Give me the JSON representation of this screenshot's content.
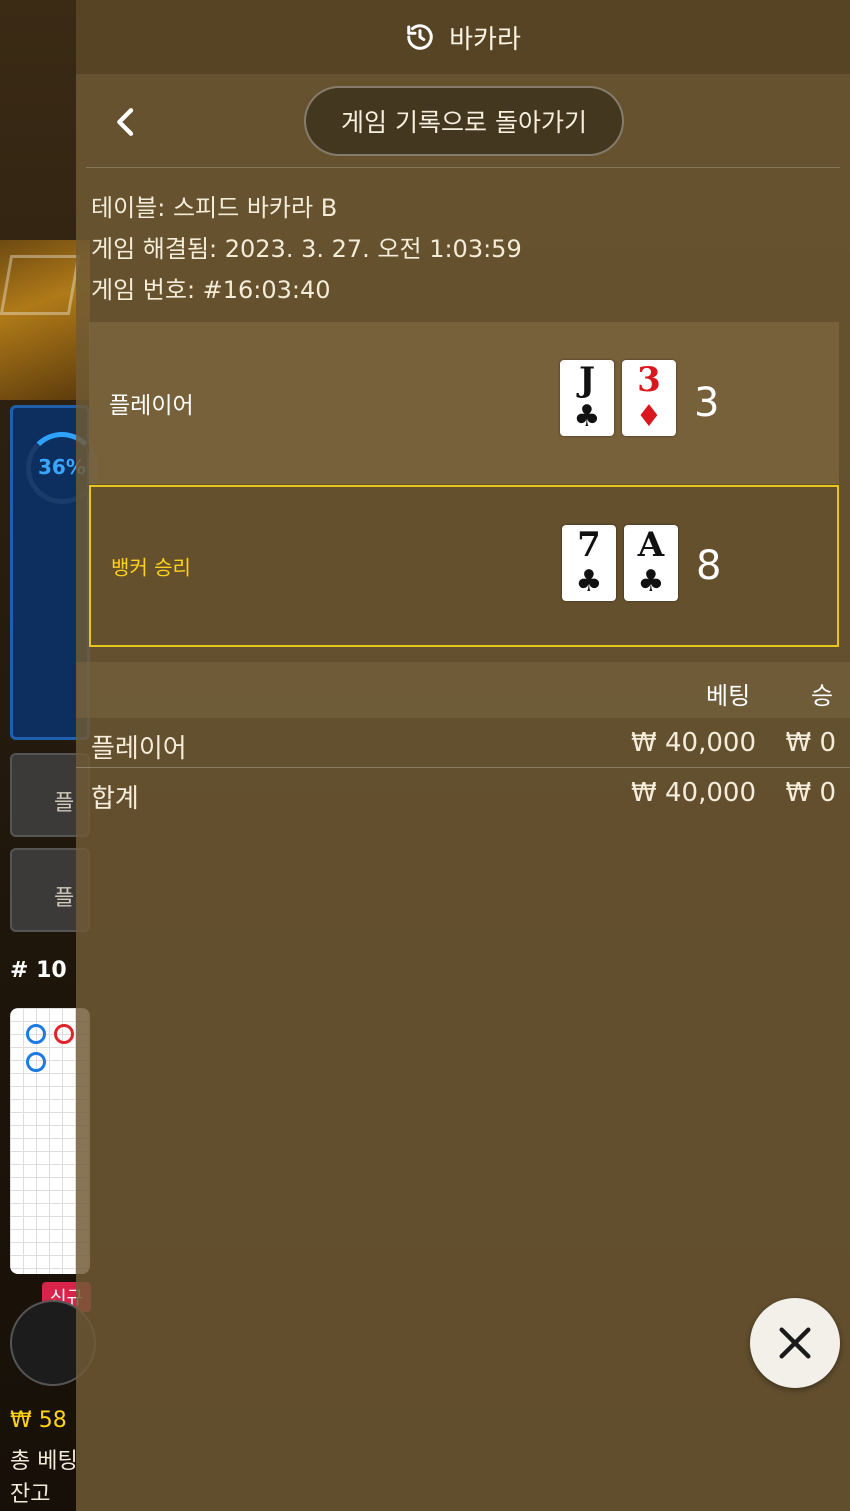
{
  "background": {
    "timer_percent": "36%",
    "side_button_1": "플",
    "side_button_2": "플",
    "round": "# 10",
    "new_badge": "신규",
    "balance_line": "₩ 58",
    "total_bet_label": "총 베팅",
    "remain_label": "잔고"
  },
  "header": {
    "title": "바카라",
    "icon": "history-icon"
  },
  "nav": {
    "back_icon": "chevron-left-icon",
    "back_label": "게임 기록으로 돌아가기"
  },
  "info": {
    "table": "테이블: 스피드 바카라 B",
    "resolved": "게임 해결됨: 2023. 3. 27. 오전 1:03:59",
    "game_number": "게임 번호: #16:03:40"
  },
  "hands": {
    "player": {
      "label": "플레이어",
      "cards": [
        {
          "rank": "J",
          "suit": "♣",
          "color": "black"
        },
        {
          "rank": "3",
          "suit": "♦",
          "color": "red"
        }
      ],
      "score": "3"
    },
    "banker": {
      "label": "뱅커 승리",
      "cards": [
        {
          "rank": "7",
          "suit": "♣",
          "color": "black"
        },
        {
          "rank": "A",
          "suit": "♣",
          "color": "black"
        }
      ],
      "score": "8"
    }
  },
  "bets": {
    "headers": {
      "bet": "베팅",
      "win": "승"
    },
    "rows": [
      {
        "name": "플레이어",
        "amount": "₩ 40,000",
        "win": "₩ 0"
      },
      {
        "name": "합계",
        "amount": "₩ 40,000",
        "win": "₩ 0"
      }
    ]
  },
  "colors": {
    "winner_highlight": "#e7c51a",
    "red_suit": "#d9171e"
  },
  "close_icon": "close-icon"
}
